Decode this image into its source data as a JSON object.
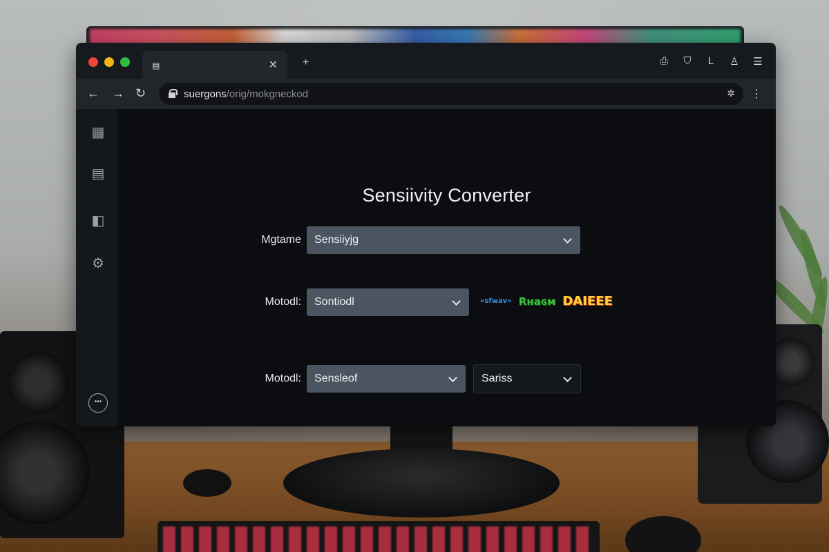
{
  "browser": {
    "tab": {
      "favicon": "tab-favicon-icon",
      "close_glyph": "✕"
    },
    "new_tab_glyph": "+",
    "title_icons": [
      "share-icon",
      "extensions-icon",
      "reading-list-icon",
      "profile-icon",
      "menu-icon"
    ],
    "address": {
      "host": "suergons",
      "path": "/orig/mokgneckod",
      "site_icon": "puzzle-icon"
    }
  },
  "sidebar": {
    "items": [
      "apps-grid-icon",
      "document-icon",
      "wallet-icon",
      "settings-gear-icon"
    ],
    "more_label": "•••"
  },
  "main": {
    "title": "Sensiivity Converter",
    "rows": [
      {
        "label": "Mgtame",
        "select_value": "Sensiiyjg"
      },
      {
        "label": "Motodl:",
        "select_value": "Sontiodl"
      },
      {
        "label": "Motodl:",
        "select_value": "Sensleof",
        "second_select_value": "Sariss"
      }
    ],
    "logos": [
      "logo-small-blue",
      "logo-green-game",
      "logo-yellow-game"
    ],
    "logo_text": [
      "«sfwav»",
      "Rʜaɢм",
      "DAIEEE"
    ]
  },
  "colors": {
    "window_bg": "#0d0f12",
    "select_bg": "#4a5561",
    "tab_bg": "#22262b",
    "traffic_red": "#f0453a",
    "traffic_yellow": "#f5b614",
    "traffic_green": "#2dc040"
  }
}
